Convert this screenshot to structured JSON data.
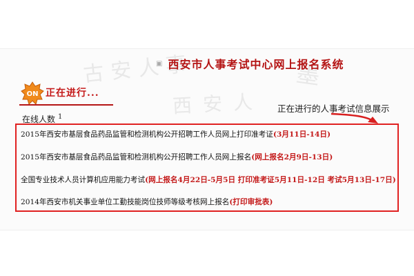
{
  "header": {
    "title": "西安市人事考试中心网上报名系统",
    "title_icon": "broken-image-icon"
  },
  "status": {
    "badge_icon": "on-badge-icon",
    "badge_text": "ON",
    "label": "正在进行..."
  },
  "online": {
    "label": "在线人数",
    "count": "1"
  },
  "annotation": {
    "text": "正在进行的人事考试信息展示",
    "arrow_color": "#d81e1e"
  },
  "exams": [
    {
      "text": "2015年西安市基层食品药品监管和检测机构公开招聘工作人员网上打印准考证",
      "tag": "(3月11日-14日)"
    },
    {
      "text": "2015年西安市基层食品药品监管和检测机构公开招聘工作人员网上报名",
      "tag": "(网上报名2月9日-13日)"
    },
    {
      "text": "全国专业技术人员计算机应用能力考试",
      "tag": "(网上报名4月22日-5月5日  打印准考证5月11日-12日  考试5月13日-17日)"
    },
    {
      "text": "2014年西安市机关事业单位工勤技能岗位技师等级考核网上报名",
      "tag": "(打印审批表)"
    }
  ],
  "colors": {
    "accent_red": "#b41414",
    "box_border": "#e02020",
    "badge_orange": "#f08a1c"
  }
}
